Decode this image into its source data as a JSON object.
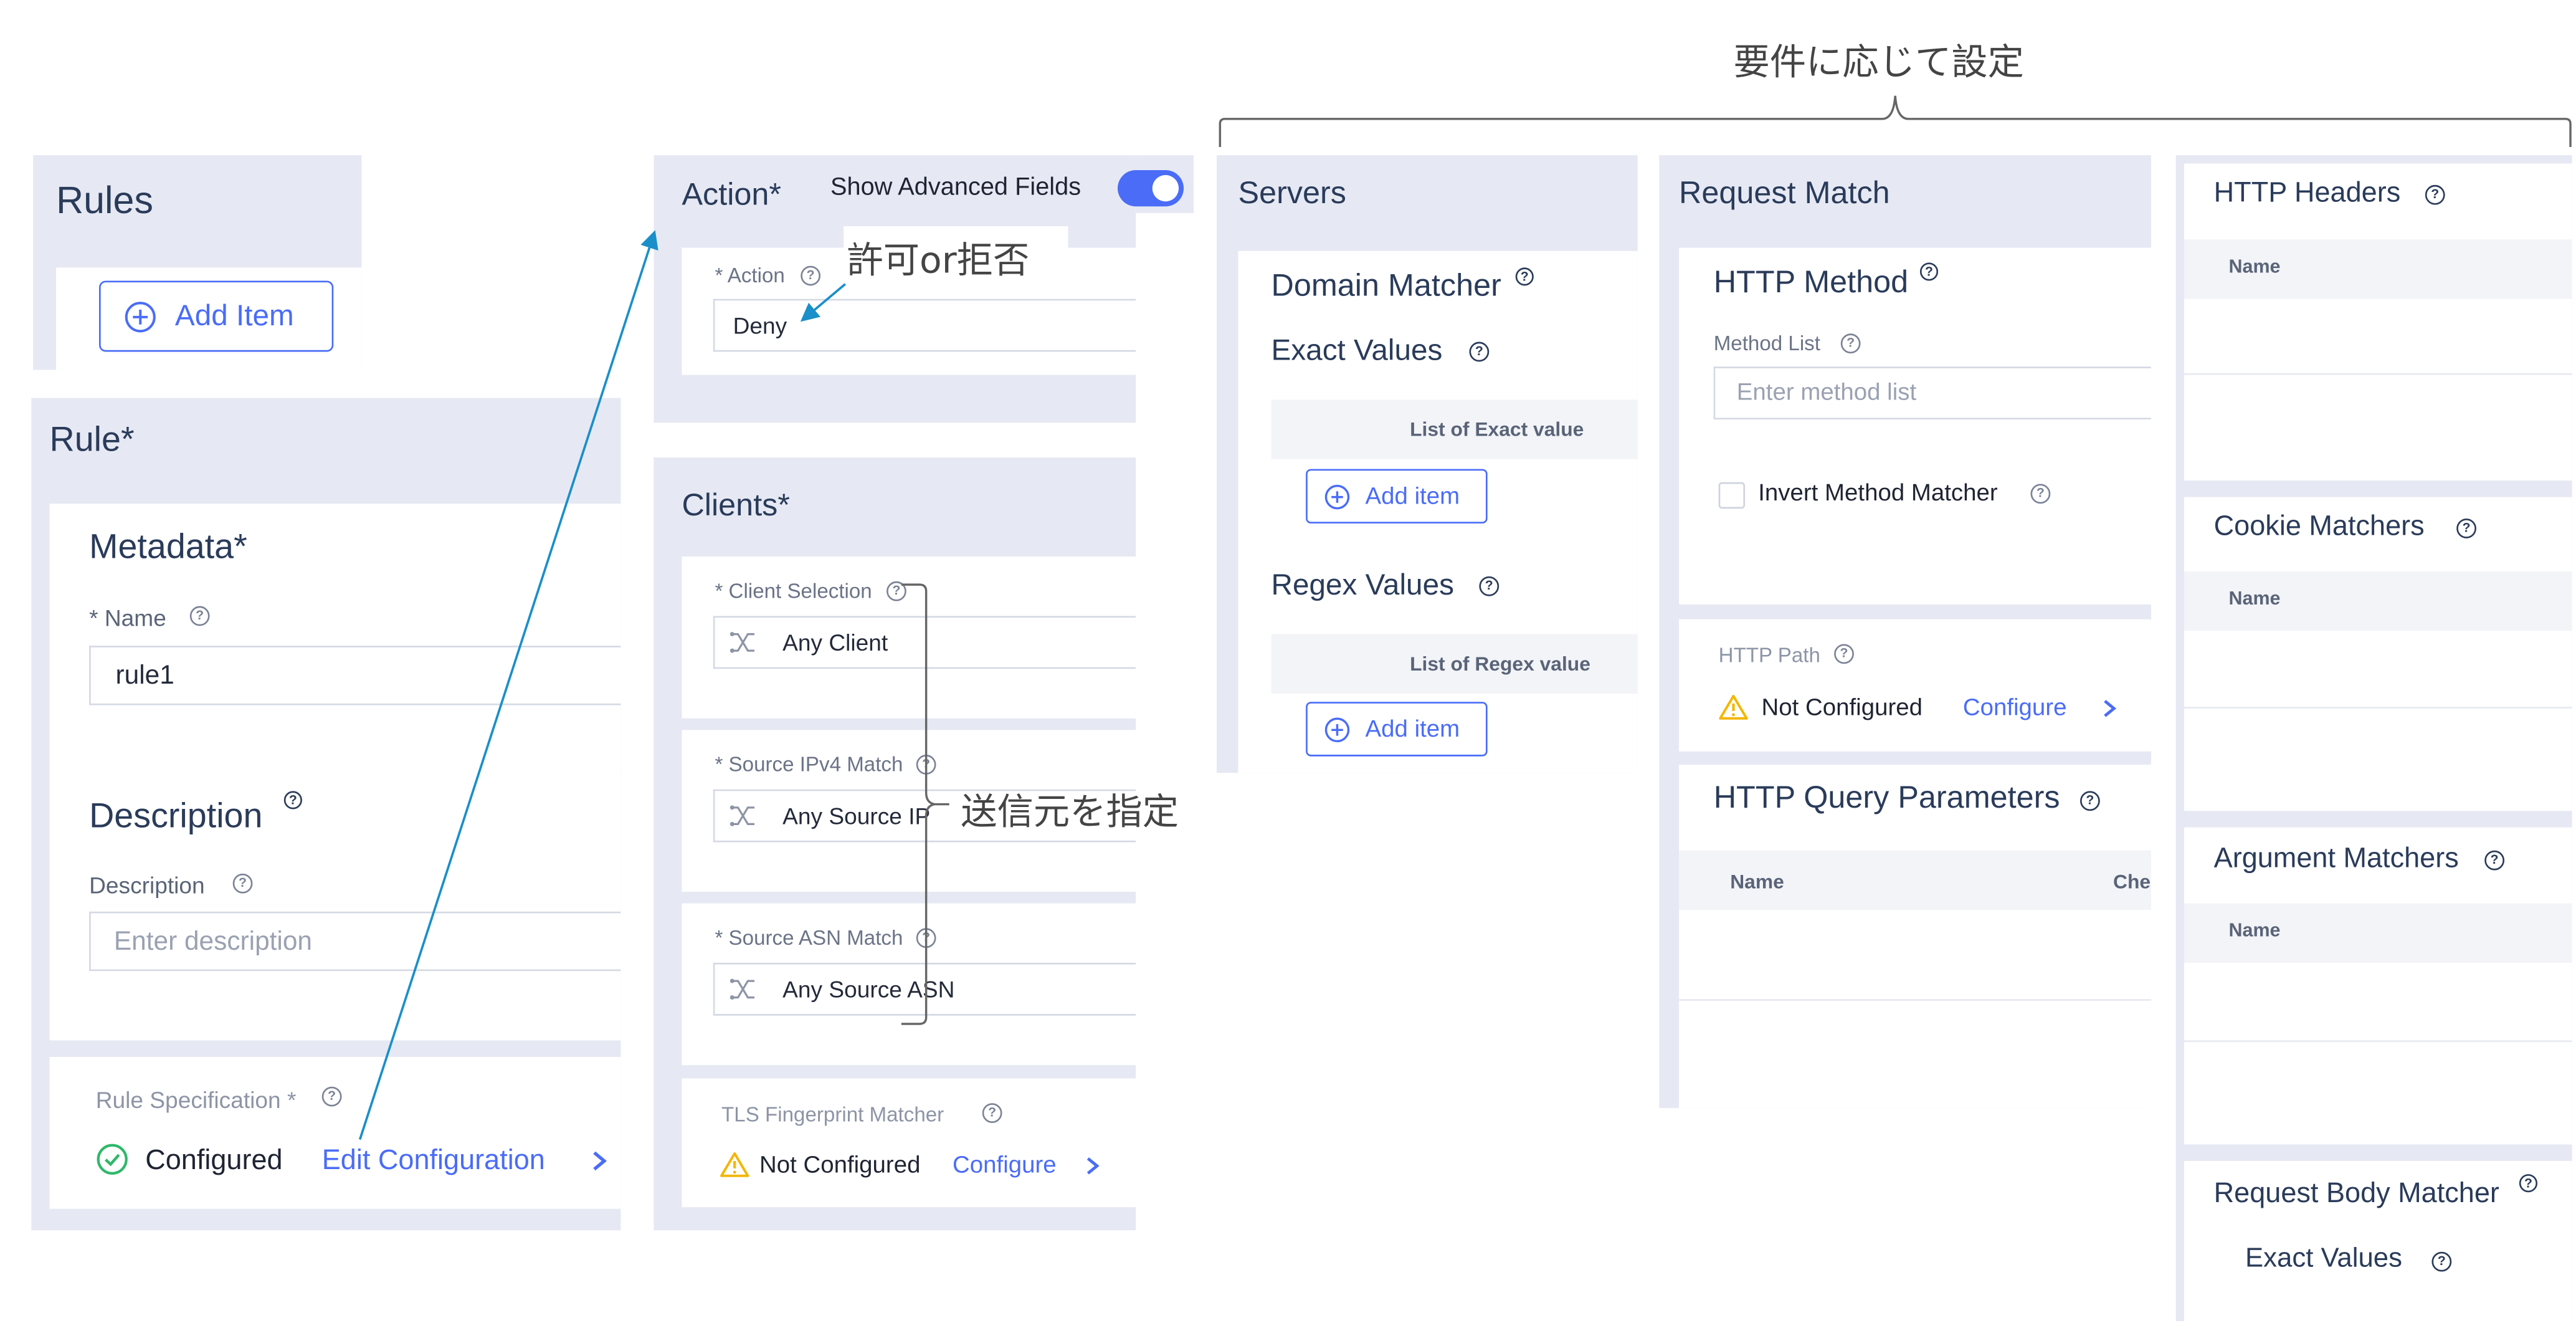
{
  "annotations": {
    "top_bracket": "要件に応じて設定",
    "action_note": "許可or拒否",
    "clients_note": "送信元を指定"
  },
  "rules": {
    "title": "Rules",
    "add_item": "Add Item"
  },
  "rule": {
    "title": "Rule",
    "required_mark": "*",
    "metadata": {
      "title": "Metadata",
      "name_label": "Name",
      "name_value": "rule1",
      "description_title": "Description",
      "description_label": "Description",
      "description_placeholder": "Enter description"
    },
    "rule_spec": {
      "label": "Rule Specification *",
      "status": "Configured",
      "edit_link": "Edit Configuration"
    }
  },
  "action": {
    "title": "Action",
    "advanced_toggle_label": "Show Advanced Fields",
    "field_label": "Action",
    "value": "Deny"
  },
  "clients": {
    "title": "Clients",
    "client_selection_label": "Client Selection",
    "client_selection_value": "Any Client",
    "source_ipv4_label": "Source IPv4 Match",
    "source_ipv4_value": "Any Source IP",
    "source_asn_label": "Source ASN Match",
    "source_asn_value": "Any Source ASN",
    "tls_label": "TLS Fingerprint Matcher",
    "tls_status": "Not Configured",
    "tls_configure": "Configure"
  },
  "servers": {
    "title": "Servers",
    "domain_matcher": "Domain Matcher",
    "exact_values": "Exact Values",
    "exact_list_header": "List of Exact value",
    "add_item_1": "Add item",
    "regex_values": "Regex Values",
    "regex_list_header": "List of Regex value",
    "add_item_2": "Add item"
  },
  "request_match": {
    "title": "Request Match",
    "http_method": "HTTP Method",
    "method_list_label": "Method List",
    "method_list_placeholder": "Enter method list",
    "invert_label": "Invert Method Matcher",
    "http_path_label": "HTTP Path",
    "http_path_status": "Not Configured",
    "http_path_configure": "Configure",
    "query_params": "HTTP Query Parameters",
    "query_col_name": "Name",
    "query_col_check": "Che"
  },
  "right_column": {
    "http_headers": "HTTP Headers",
    "headers_col": "Name",
    "cookie_matchers": "Cookie Matchers",
    "cookie_col": "Name",
    "argument_matchers": "Argument Matchers",
    "argument_col": "Name",
    "request_body_matcher": "Request Body Matcher",
    "body_exact_values": "Exact Values"
  },
  "colors": {
    "panel_bg": "#e6e9f3",
    "accent": "#4a6cf7",
    "success": "#2fb86a",
    "warning": "#f2b705",
    "annotation_line": "#1a8fc9"
  }
}
